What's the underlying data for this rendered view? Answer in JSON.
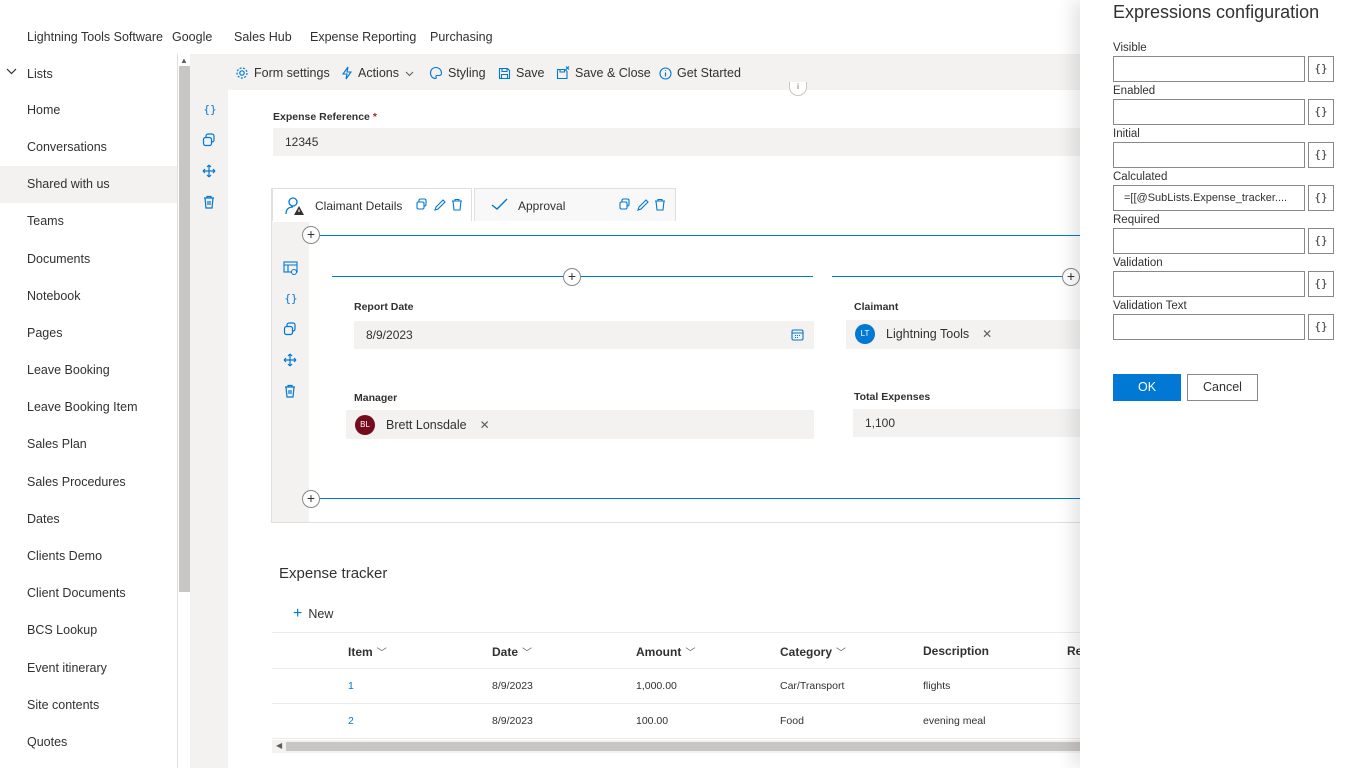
{
  "topnav": {
    "links": [
      "Lightning Tools Software",
      "Google",
      "Sales Hub",
      "Expense Reporting",
      "Purchasing"
    ]
  },
  "leftnav": {
    "header": "Lists",
    "items": [
      "Home",
      "Conversations",
      "Shared with us",
      "Teams",
      "Documents",
      "Notebook",
      "Pages",
      "Leave Booking",
      "Leave Booking Item",
      "Sales Plan",
      "Sales Procedures",
      "Dates",
      "Clients Demo",
      "Client Documents",
      "BCS Lookup",
      "Event itinerary",
      "Site contents",
      "Quotes"
    ],
    "active": "Shared with us"
  },
  "toolbar": {
    "form_settings": "Form settings",
    "actions": "Actions",
    "styling": "Styling",
    "save": "Save",
    "save_close": "Save & Close",
    "get_started": "Get Started"
  },
  "form": {
    "expense_reference_label": "Expense Reference",
    "required_mark": "*",
    "expense_reference_value": "12345",
    "tabs": [
      "Claimant Details",
      "Approval"
    ],
    "report_date_label": "Report Date",
    "report_date_value": "8/9/2023",
    "claimant_label": "Claimant",
    "claimant_initials": "LT",
    "claimant_name": "Lightning Tools",
    "manager_label": "Manager",
    "manager_initials": "BL",
    "manager_name": "Brett Lonsdale",
    "total_expenses_label": "Total Expenses",
    "total_expenses_value": "1,100"
  },
  "expense_tracker": {
    "title": "Expense tracker",
    "new_label": "New",
    "columns": [
      "Item",
      "Date",
      "Amount",
      "Category",
      "Description",
      "Re"
    ],
    "rows": [
      {
        "item": "1",
        "date": "8/9/2023",
        "amount": "1,000.00",
        "category": "Car/Transport",
        "description": "flights"
      },
      {
        "item": "2",
        "date": "8/9/2023",
        "amount": "100.00",
        "category": "Food",
        "description": "evening meal"
      }
    ]
  },
  "panel": {
    "title": "Expressions configuration",
    "fields": [
      {
        "label": "Visible",
        "value": ""
      },
      {
        "label": "Enabled",
        "value": ""
      },
      {
        "label": "Initial",
        "value": ""
      },
      {
        "label": "Calculated",
        "value": "=[[@SubLists.Expense_tracker...."
      },
      {
        "label": "Required",
        "value": ""
      },
      {
        "label": "Validation",
        "value": ""
      },
      {
        "label": "Validation Text",
        "value": ""
      }
    ],
    "fx_label": "{}",
    "ok_label": "OK",
    "cancel_label": "Cancel"
  },
  "colors": {
    "accent": "#0078d4",
    "claimant_avatar": "#0078d4",
    "manager_avatar": "#750b1c"
  }
}
